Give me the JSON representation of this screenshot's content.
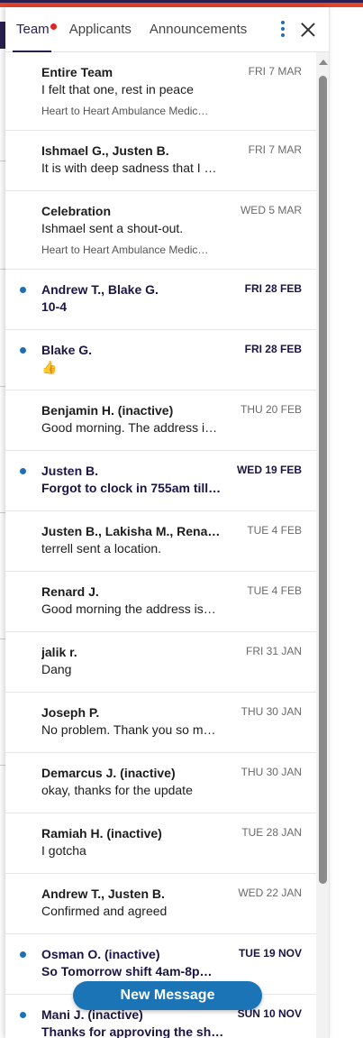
{
  "tabs": {
    "team": "Team",
    "applicants": "Applicants",
    "announcements": "Announcements"
  },
  "icons": {
    "more": "vertical-dots-icon",
    "close": "close-icon",
    "unread": "unread-dot-icon"
  },
  "colors": {
    "accent": "#2b1f52",
    "unread_dot": "#1f6fb5",
    "notification_dot": "#d8281f",
    "button": "#1a74b6"
  },
  "conversations": [
    {
      "name": "Entire Team",
      "date": "FRI 7 MAR",
      "preview": "I felt that one, rest in peace",
      "sub": "Heart to Heart Ambulance Medic…",
      "unread": false
    },
    {
      "name": "Ishmael G., Justen B.",
      "date": "FRI 7 MAR",
      "preview": "It is with deep sadness that I …",
      "sub": "",
      "unread": false
    },
    {
      "name": "Celebration",
      "date": "WED 5 MAR",
      "preview": "Ishmael sent a shout-out.",
      "sub": "Heart to Heart Ambulance Medic…",
      "unread": false
    },
    {
      "name": "Andrew T., Blake G.",
      "date": "FRI 28 FEB",
      "preview": "10-4",
      "sub": "",
      "unread": true
    },
    {
      "name": "Blake G.",
      "date": "FRI 28 FEB",
      "preview": "👍",
      "sub": "",
      "unread": true
    },
    {
      "name": "Benjamin H. (inactive)",
      "date": "THU 20 FEB",
      "preview": "Good morning. The address i…",
      "sub": "",
      "unread": false
    },
    {
      "name": "Justen B.",
      "date": "WED 19 FEB",
      "preview": "Forgot to clock in 755am till …",
      "sub": "",
      "unread": true
    },
    {
      "name": "Justen B., Lakisha M., Renar…",
      "date": "TUE 4 FEB",
      "preview": "terrell sent a location.",
      "sub": "",
      "unread": false
    },
    {
      "name": "Renard J.",
      "date": "TUE 4 FEB",
      "preview": "Good morning the address is…",
      "sub": "",
      "unread": false
    },
    {
      "name": "jalik r.",
      "date": "FRI 31 JAN",
      "preview": "Dang",
      "sub": "",
      "unread": false
    },
    {
      "name": "Joseph P.",
      "date": "THU 30 JAN",
      "preview": "No problem. Thank you so m…",
      "sub": "",
      "unread": false
    },
    {
      "name": "Demarcus J. (inactive)",
      "date": "THU 30 JAN",
      "preview": "okay, thanks for the update",
      "sub": "",
      "unread": false
    },
    {
      "name": "Ramiah H. (inactive)",
      "date": "TUE 28 JAN",
      "preview": "I gotcha",
      "sub": "",
      "unread": false
    },
    {
      "name": "Andrew T., Justen B.",
      "date": "WED 22 JAN",
      "preview": "Confirmed and agreed",
      "sub": "",
      "unread": false
    },
    {
      "name": "Osman O. (inactive)",
      "date": "TUE 19 NOV",
      "preview": "So Tomorrow shift 4am-8p…",
      "sub": "",
      "unread": true
    },
    {
      "name": "Mani J. (inactive)",
      "date": "SUN 10 NOV",
      "preview": "Thanks for approving the shi…",
      "sub": "",
      "unread": true
    }
  ],
  "new_message_button": "New Message"
}
